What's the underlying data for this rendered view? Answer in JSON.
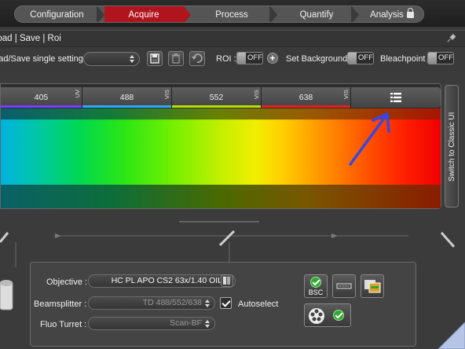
{
  "workflow": {
    "steps": [
      {
        "label": "Configuration",
        "active": false
      },
      {
        "label": "Acquire",
        "active": true
      },
      {
        "label": "Process",
        "active": false
      },
      {
        "label": "Quantify",
        "active": false
      },
      {
        "label": "Analysis",
        "active": false,
        "locked": true
      }
    ]
  },
  "load_save": {
    "title": "Load | Save | Roi",
    "setting_label": "Load/Save single setting :",
    "setting_value": "",
    "roi_label": "ROI :",
    "roi_toggle": "OFF",
    "set_background_label": "Set Background :",
    "set_background_toggle": "OFF",
    "bleachpoint_label": "Bleachpoint :",
    "bleachpoint_toggle": "OFF"
  },
  "lasers": [
    {
      "wavelength": "405",
      "type": "UV",
      "color": "#7a3cff"
    },
    {
      "wavelength": "488",
      "type": "VIS",
      "color": "#2aa9ff"
    },
    {
      "wavelength": "552",
      "type": "VIS",
      "color": "#b8e000"
    },
    {
      "wavelength": "638",
      "type": "VIS",
      "color": "#e02020"
    }
  ],
  "classic_ui_label": "Switch to Classic UI",
  "annotation_arrow_color": "#3548e6",
  "objective": {
    "label": "Objective :",
    "value": "HC PL APO CS2   63x/1.40 OIL"
  },
  "beamsplitter": {
    "label": "Beamsplitter :",
    "value": "TD 488/552/638",
    "autoselect_label": "Autoselect",
    "autoselect_checked": true
  },
  "fluo_turret": {
    "label": "Fluo Turret :",
    "value": "Scan-BF"
  },
  "bsc_label": "BSC"
}
